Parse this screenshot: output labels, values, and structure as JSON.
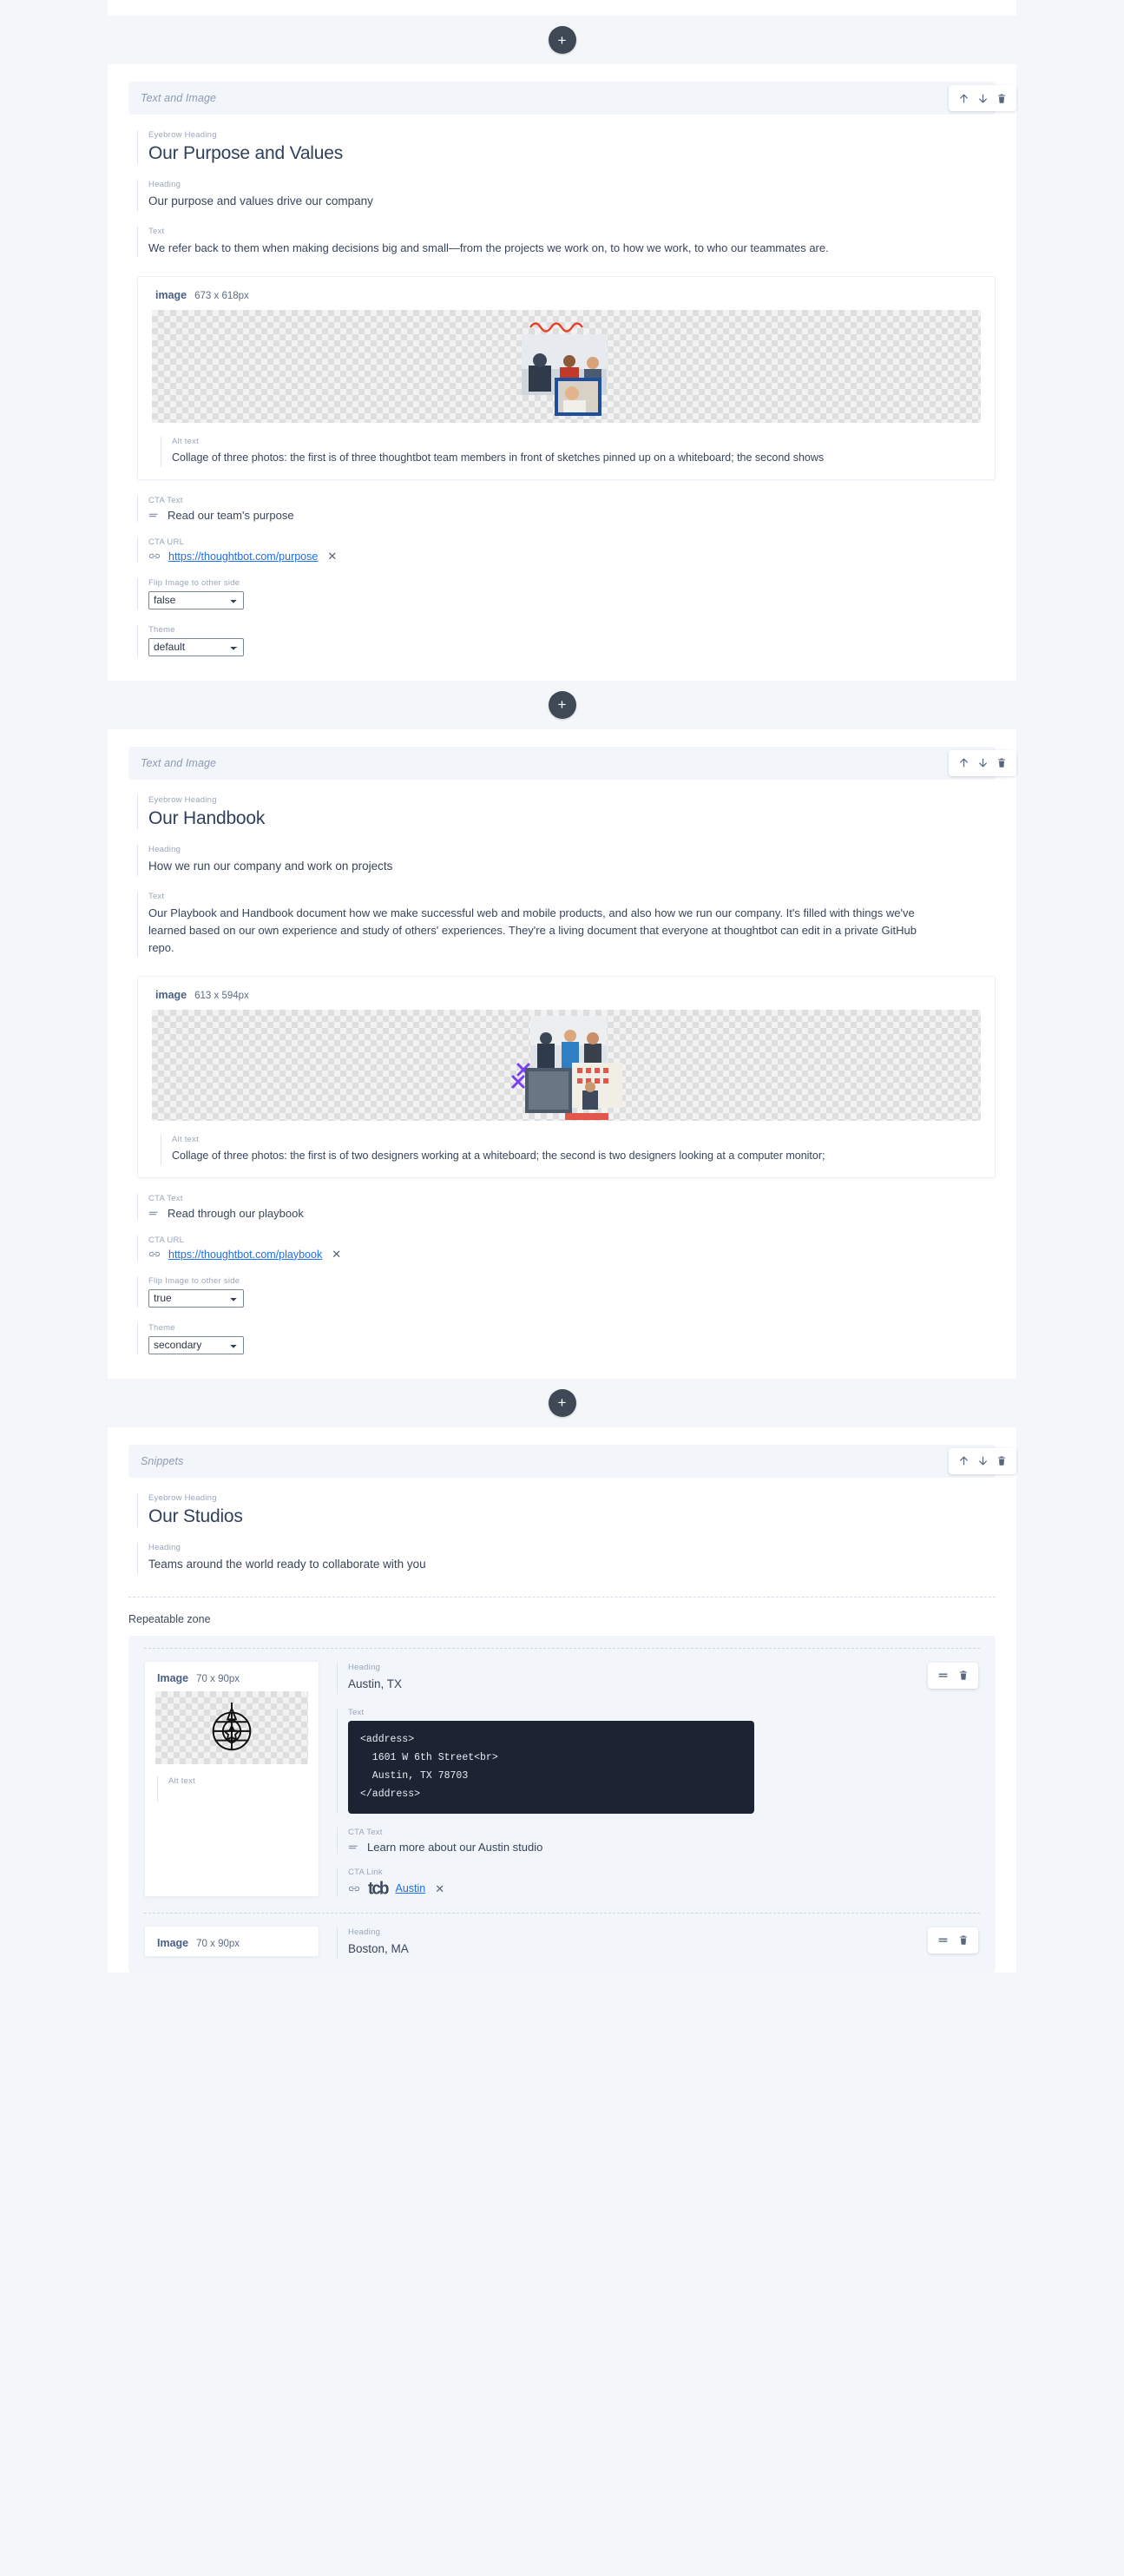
{
  "add_button_label": "+",
  "tools": {
    "move_up": "Move up",
    "move_down": "Move down",
    "delete": "Delete",
    "drag": "Drag to reorder"
  },
  "blocks": [
    {
      "type_label": "Text and Image",
      "fields": {
        "eyebrow_label": "Eyebrow Heading",
        "eyebrow_value": "Our Purpose and Values",
        "heading_label": "Heading",
        "heading_value": "Our purpose and values drive our company",
        "text_label": "Text",
        "text_value": "We refer back to them when making decisions big and small—from the projects we work on, to how we work, to who our teammates are.",
        "image_name": "image",
        "image_dims": "673 x 618px",
        "alt_label": "Alt text",
        "alt_value": "Collage of three photos: the first is of three thoughtbot team members in front of sketches pinned up on a whiteboard; the second shows",
        "cta_text_label": "CTA Text",
        "cta_text_value": "Read our team's purpose",
        "cta_url_label": "CTA URL",
        "cta_url_value": "https://thoughtbot.com/purpose",
        "flip_label": "Flip Image to other side",
        "flip_value": "false",
        "theme_label": "Theme",
        "theme_value": "default"
      }
    },
    {
      "type_label": "Text and Image",
      "fields": {
        "eyebrow_label": "Eyebrow Heading",
        "eyebrow_value": "Our Handbook",
        "heading_label": "Heading",
        "heading_value": "How we run our company and work on projects",
        "text_label": "Text",
        "text_value": "Our Playbook and Handbook document how we make successful web and mobile products, and also how we run our company. It's filled with things we've learned based on our own experience and study of others' experiences. They're a living document that everyone at thoughtbot can edit in a private GitHub repo.",
        "image_name": "image",
        "image_dims": "613 x 594px",
        "alt_label": "Alt text",
        "alt_value": "Collage of three photos: the first is of two designers working at a whiteboard; the second is two designers looking at a computer monitor;",
        "cta_text_label": "CTA Text",
        "cta_text_value": "Read through our playbook",
        "cta_url_label": "CTA URL",
        "cta_url_value": "https://thoughtbot.com/playbook",
        "flip_label": "Flip Image to other side",
        "flip_value": "true",
        "theme_label": "Theme",
        "theme_value": "secondary"
      }
    }
  ],
  "select_options": {
    "flip": [
      "true",
      "false"
    ],
    "theme": [
      "default",
      "secondary"
    ]
  },
  "snippets_block": {
    "type_label": "Snippets",
    "eyebrow_label": "Eyebrow Heading",
    "eyebrow_value": "Our Studios",
    "heading_label": "Heading",
    "heading_value": "Teams around the world ready to collaborate with you",
    "repeatable_zone_label": "Repeatable zone",
    "items": [
      {
        "image_name": "Image",
        "image_dims": "70 x 90px",
        "alt_label": "Alt text",
        "alt_value": "",
        "heading_label": "Heading",
        "heading_value": "Austin, TX",
        "text_label": "Text",
        "code_value": "<address>\n  1601 W 6th Street<br>\n  Austin, TX 78703\n</address>",
        "cta_text_label": "CTA Text",
        "cta_text_value": "Learn more  about our Austin studio",
        "cta_link_label": "CTA Link",
        "cta_link_value": "Austin",
        "cta_link_mark": "tcb"
      },
      {
        "image_name": "Image",
        "image_dims": "70 x 90px",
        "heading_label": "Heading",
        "heading_value": "Boston, MA"
      }
    ]
  }
}
